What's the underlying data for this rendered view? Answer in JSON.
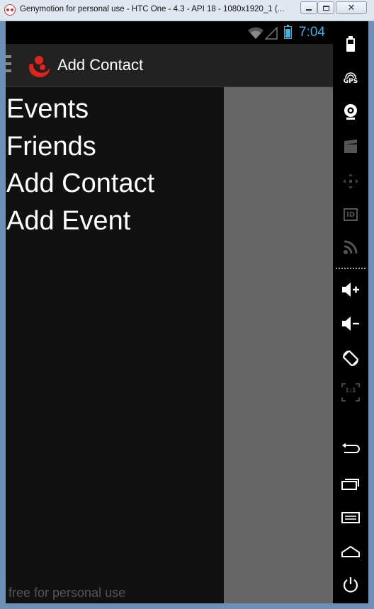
{
  "window": {
    "title": "Genymotion for personal use - HTC One - 4.3 - API 18 - 1080x1920_1 (...",
    "minimize_glyph": "",
    "maximize_glyph": "",
    "close_glyph": "✕"
  },
  "statusbar": {
    "time": "7:04",
    "accent_color": "#33b5e5"
  },
  "actionbar": {
    "title": "Add Contact",
    "logo_color": "#e2231a"
  },
  "drawer": {
    "items": [
      {
        "label": "Events"
      },
      {
        "label": "Friends"
      },
      {
        "label": "Add Contact"
      },
      {
        "label": "Add Event"
      }
    ]
  },
  "watermark": "free for personal use",
  "toolbar": {
    "gps_label": "GPS",
    "id_label": "ID",
    "pixel_label": "1:1",
    "icons": [
      "battery-icon",
      "gps-icon",
      "webcam-icon",
      "camera-clap-icon",
      "move-icon",
      "id-icon",
      "cast-icon",
      "volume-up-icon",
      "volume-down-icon",
      "rotate-icon",
      "pixel-perfect-icon",
      "back-icon",
      "recent-apps-icon",
      "menu-icon",
      "home-icon",
      "power-icon"
    ]
  }
}
